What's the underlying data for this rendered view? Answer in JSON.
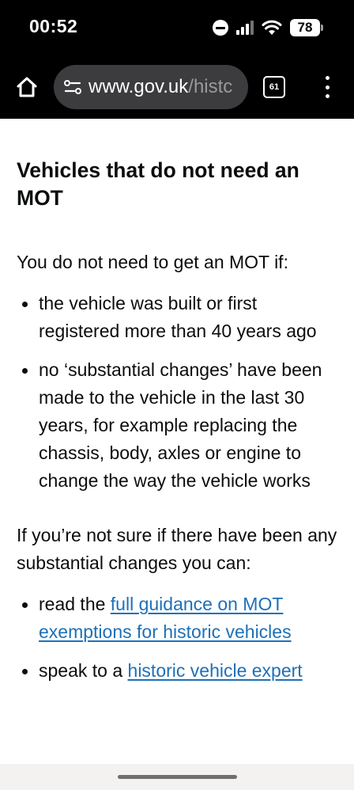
{
  "status_bar": {
    "time": "00:52",
    "battery_level": "78",
    "icons": [
      "do-not-disturb-icon",
      "signal-icon",
      "wifi-icon",
      "battery-icon"
    ]
  },
  "browser": {
    "url_host": "www.gov.uk",
    "url_path": "/histc",
    "tab_count": "61",
    "icons": [
      "home-icon",
      "site-info-icon",
      "tabs-icon",
      "more-menu-icon"
    ]
  },
  "article": {
    "heading": "Vehicles that do not need an MOT",
    "intro": "You do not need to get an MOT if:",
    "conditions": [
      "the vehicle was built or first registered more than 40 years ago",
      "no ‘substantial changes’ have been made to the vehicle in the last 30 years, for example replacing the chassis, body, axles or engine to change the way the vehicle works"
    ],
    "unsure_text": "If you’re not sure if there have been any substantial changes you can:",
    "actions": [
      {
        "prefix": "read the ",
        "link_text": "full guidance on MOT exemptions for historic vehicles"
      },
      {
        "prefix": "speak to a ",
        "link_text": "historic vehicle expert"
      }
    ]
  },
  "colors": {
    "text": "#0b0c0c",
    "link": "#1d70b8",
    "chrome_bg": "#000000",
    "url_bar_bg": "#3c3c3e"
  }
}
